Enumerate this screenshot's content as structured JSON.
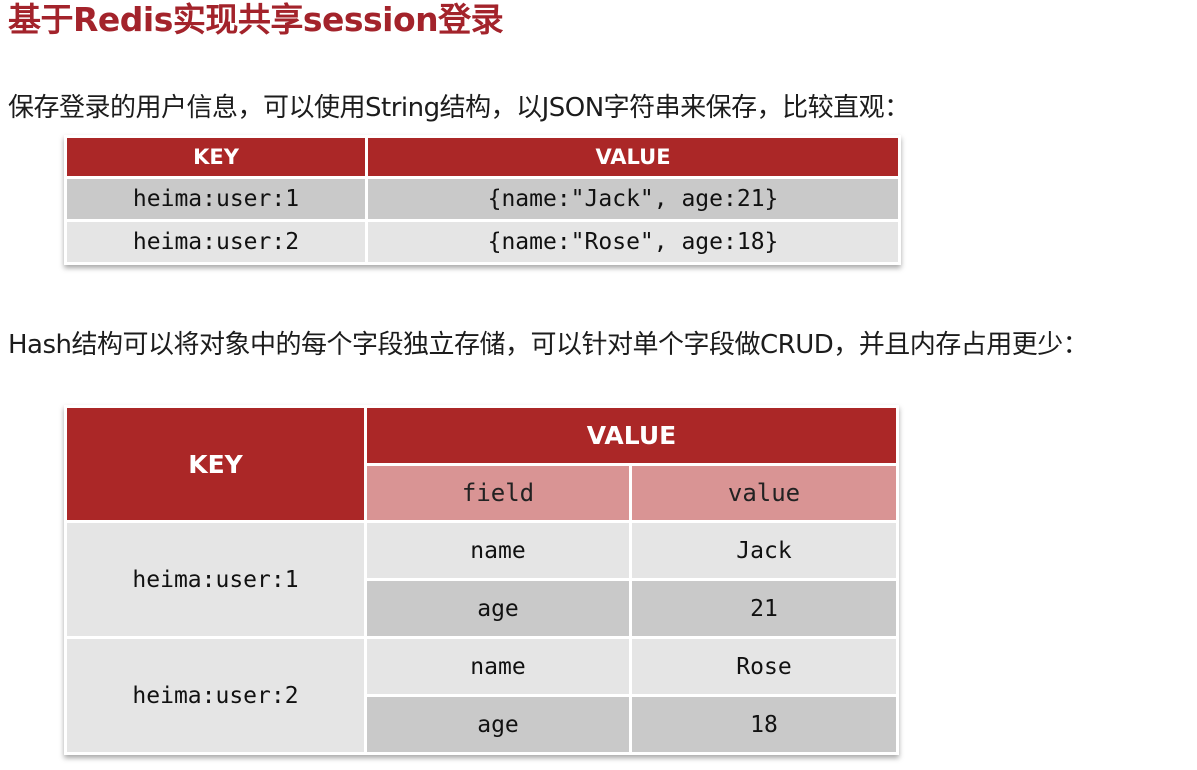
{
  "title": "基于Redis实现共享session登录",
  "paragraph1": "保存登录的用户信息，可以使用String结构，以JSON字符串来保存，比较直观：",
  "table1": {
    "headers": [
      "KEY",
      "VALUE"
    ],
    "rows": [
      {
        "key": "heima:user:1",
        "value": "{name:\"Jack\", age:21}"
      },
      {
        "key": "heima:user:2",
        "value": "{name:\"Rose\", age:18}"
      }
    ]
  },
  "paragraph2": "Hash结构可以将对象中的每个字段独立存储，可以针对单个字段做CRUD，并且内存占用更少：",
  "table2": {
    "key_header": "KEY",
    "value_header": "VALUE",
    "sub_headers": [
      "field",
      "value"
    ],
    "rows": [
      {
        "key": "heima:user:1",
        "fields": [
          {
            "field": "name",
            "value": "Jack"
          },
          {
            "field": "age",
            "value": "21"
          }
        ]
      },
      {
        "key": "heima:user:2",
        "fields": [
          {
            "field": "name",
            "value": "Rose"
          },
          {
            "field": "age",
            "value": "18"
          }
        ]
      }
    ]
  },
  "colors": {
    "title": "#a3232b",
    "header_bg": "#ab2727",
    "subheader_bg": "#d99494",
    "row_light": "#e5e5e5",
    "row_dark": "#c9c9c9"
  }
}
